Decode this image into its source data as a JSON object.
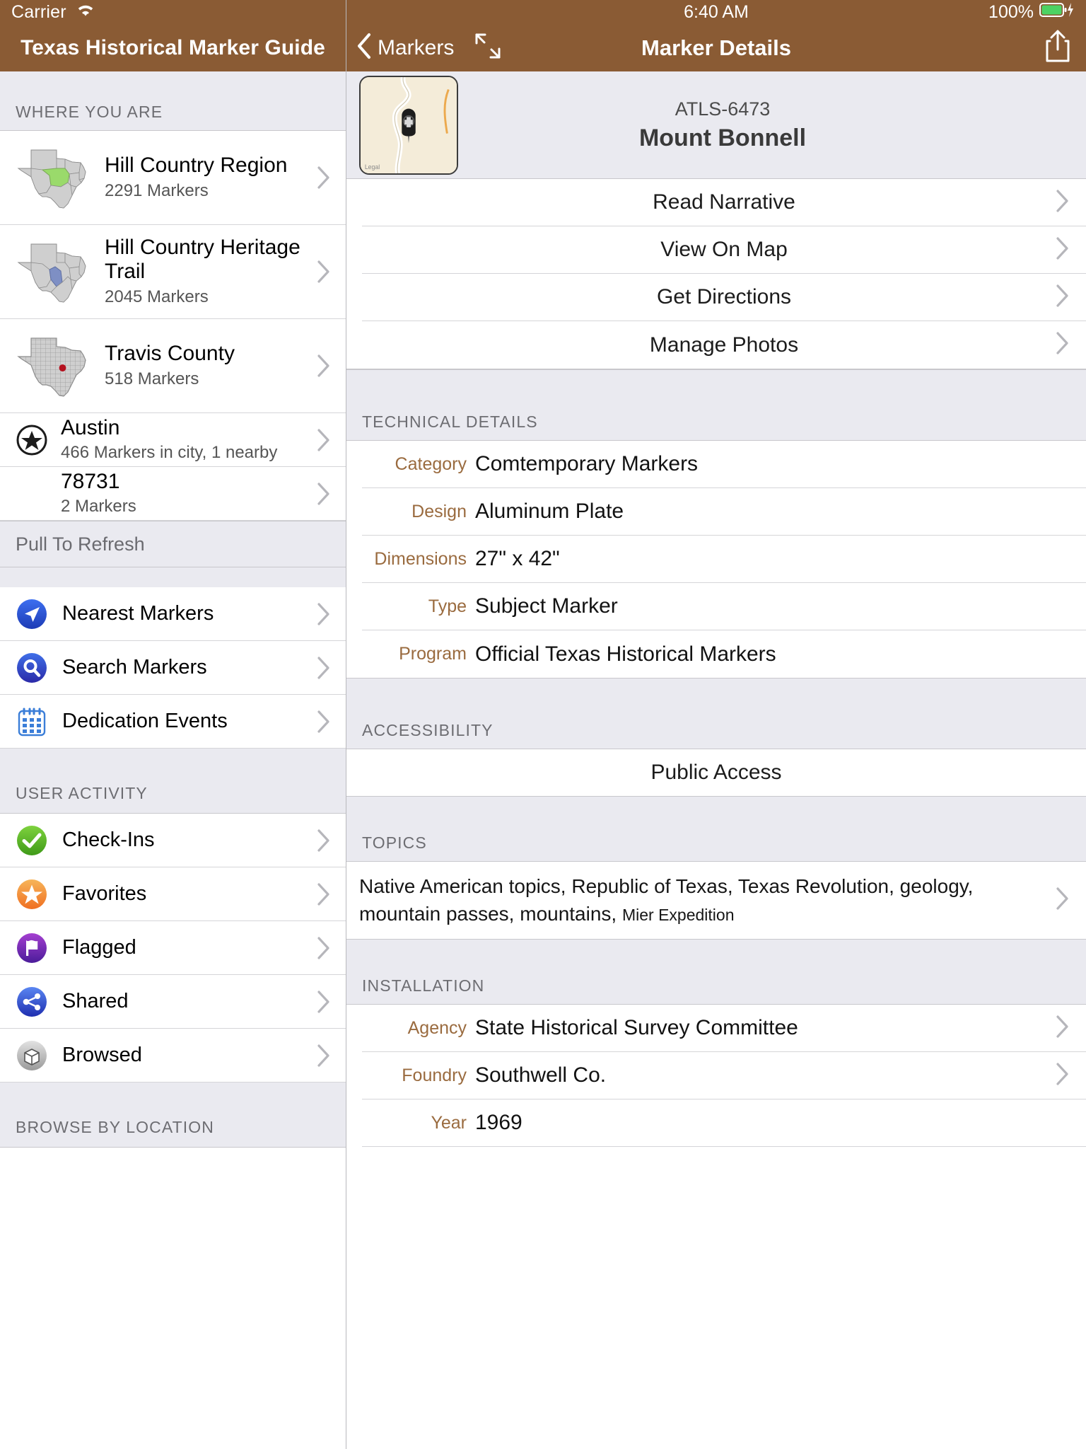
{
  "status_bar": {
    "carrier": "Carrier",
    "wifi_icon": "wifi-icon",
    "time": "6:40 AM",
    "battery_percent": "100%",
    "battery_icon": "battery-full-charging-icon"
  },
  "sidebar": {
    "title": "Texas Historical Marker Guide",
    "sections": [
      {
        "header": "WHERE YOU ARE"
      },
      {
        "header": "USER ACTIVITY"
      },
      {
        "header": "BROWSE BY LOCATION"
      }
    ],
    "where_you_are": [
      {
        "name": "Hill Country Region",
        "detail": "2291 Markers",
        "thumb": "texas-regions-map-green"
      },
      {
        "name": "Hill Country Heritage Trail",
        "detail": "2045 Markers",
        "thumb": "texas-regions-map-blue"
      },
      {
        "name": "Travis County",
        "detail": "518 Markers",
        "thumb": "texas-counties-map-red"
      },
      {
        "name": "Austin",
        "detail": "466 Markers in city, 1 nearby",
        "icon": "star-circle-icon"
      },
      {
        "name": "78731",
        "detail": "2 Markers",
        "icon": "none"
      }
    ],
    "pull_to_refresh": "Pull To Refresh",
    "actions": [
      {
        "label": "Nearest Markers",
        "icon": "navigation-arrow-icon"
      },
      {
        "label": "Search Markers",
        "icon": "search-icon"
      },
      {
        "label": "Dedication Events",
        "icon": "calendar-icon"
      }
    ],
    "user_activity": [
      {
        "label": "Check-Ins",
        "icon": "check-circle-icon"
      },
      {
        "label": "Favorites",
        "icon": "star-circle-orange-icon"
      },
      {
        "label": "Flagged",
        "icon": "flag-circle-purple-icon"
      },
      {
        "label": "Shared",
        "icon": "share-circle-blue-icon"
      },
      {
        "label": "Browsed",
        "icon": "box-circle-grey-icon"
      }
    ]
  },
  "detail": {
    "back_label": "Markers",
    "title": "Marker Details",
    "expand_icon": "expand-diagonal-icon",
    "share_icon": "share-up-icon",
    "hero": {
      "thumbnail": "mini-map-with-marker-pin",
      "atls_id": "ATLS-6473",
      "marker_name": "Mount Bonnell"
    },
    "actions": [
      {
        "label": "Read Narrative"
      },
      {
        "label": "View On Map"
      },
      {
        "label": "Get Directions"
      },
      {
        "label": "Manage Photos"
      }
    ],
    "technical_details": {
      "header": "TECHNICAL DETAILS",
      "rows": [
        {
          "key": "Category",
          "value": "Comtemporary Markers"
        },
        {
          "key": "Design",
          "value": "Aluminum Plate"
        },
        {
          "key": "Dimensions",
          "value": "27\" x 42\""
        },
        {
          "key": "Type",
          "value": "Subject Marker"
        },
        {
          "key": "Program",
          "value": "Official Texas Historical Markers"
        }
      ]
    },
    "accessibility": {
      "header": "ACCESSIBILITY",
      "value": "Public Access"
    },
    "topics": {
      "header": "TOPICS",
      "main": "Native American topics, Republic of Texas, Texas Revolution, geology, mountain passes, mountains, ",
      "trailing": "Mier Expedition"
    },
    "installation": {
      "header": "INSTALLATION",
      "rows": [
        {
          "key": "Agency",
          "value": "State Historical Survey Committee"
        },
        {
          "key": "Foundry",
          "value": "Southwell Co."
        },
        {
          "key": "Year",
          "value": "1969"
        }
      ]
    }
  },
  "colors": {
    "nav_brown": "#8a5b34",
    "section_grey": "#eaeaf0",
    "key_brown": "#9a6b3f",
    "chevron_grey": "#b6b6bb",
    "battery_green": "#4cd263"
  }
}
